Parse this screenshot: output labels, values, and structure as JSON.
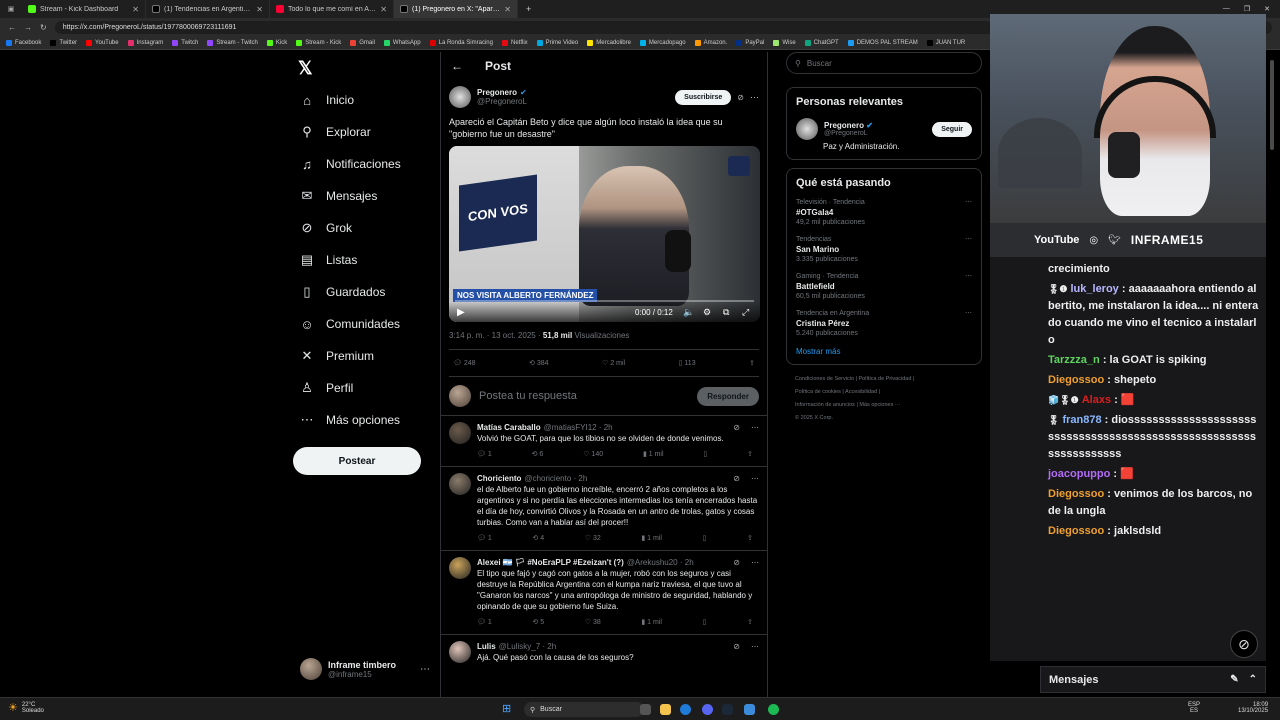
{
  "browser": {
    "tabs": [
      {
        "title": "Stream - Kick Dashboard",
        "color": "#53fc18"
      },
      {
        "title": "(1) Tendencias en Argentina (@p",
        "color": "#000000"
      },
      {
        "title": "Todo lo que me comí en Argentina",
        "color": "#ff0033"
      },
      {
        "title": "(1) Pregonero en X: \"Apareció el",
        "color": "#000000"
      }
    ],
    "url": "https://x.com/PregoneroL/status/1977800069723111691",
    "bookmarks": [
      "Facebook",
      "Twitter",
      "YouTube",
      "Instagram",
      "Twitch",
      "Stream - Twitch",
      "Kick",
      "Stream - Kick",
      "Gmail",
      "WhatsApp",
      "La Ronda Simracing",
      "Netflix",
      "Prime Video",
      "Mercadolibre",
      "Mercadopago",
      "Amazon.",
      "PayPal",
      "Wise",
      "ChatGPT",
      "DEMOS PAL STREAM",
      "JUAN TUR"
    ]
  },
  "nav": {
    "items": [
      {
        "label": "Inicio",
        "icon": "home-icon",
        "glyph": "⌂"
      },
      {
        "label": "Explorar",
        "icon": "search-icon",
        "glyph": "⚲"
      },
      {
        "label": "Notificaciones",
        "icon": "bell-icon",
        "glyph": "♫"
      },
      {
        "label": "Mensajes",
        "icon": "mail-icon",
        "glyph": "✉"
      },
      {
        "label": "Grok",
        "icon": "grok-icon",
        "glyph": "⊘"
      },
      {
        "label": "Listas",
        "icon": "list-icon",
        "glyph": "▤"
      },
      {
        "label": "Guardados",
        "icon": "bookmark-icon",
        "glyph": "▯"
      },
      {
        "label": "Comunidades",
        "icon": "communities-icon",
        "glyph": "☺"
      },
      {
        "label": "Premium",
        "icon": "x-logo-icon",
        "glyph": "✕"
      },
      {
        "label": "Perfil",
        "icon": "profile-icon",
        "glyph": "♙"
      },
      {
        "label": "Más opciones",
        "icon": "more-icon",
        "glyph": "⋯"
      }
    ],
    "post_button": "Postear",
    "account_name": "Inframe timbero",
    "account_handle": "@inframe15"
  },
  "post": {
    "header_title": "Post",
    "author_name": "Pregonero",
    "author_handle": "@PregoneroL",
    "subscribe": "Suscribirse",
    "text": "Apareció el Capitán Beto y dice que algún loco instaló la idea que su \"gobierno fue un desastre\"",
    "video": {
      "overlay_caption": "NOS VISITA ALBERTO FERNÁNDEZ",
      "logo_text": "CON VOS",
      "time": "0:00 / 0:12",
      "progress": 0
    },
    "timestamp": "3:14 p. m. · 13 oct. 2025 ·",
    "views_count": "51,8 mil",
    "views_label": "Visualizaciones",
    "replies": "248",
    "reposts": "384",
    "likes": "2 mil",
    "bookmarks": "113",
    "reply_placeholder": "Postea tu respuesta",
    "reply_button": "Responder"
  },
  "replies": [
    {
      "name": "Matías Caraballo",
      "handle": "@matiasFYI12 · 2h",
      "text": "Volvió the GOAT, para que los tibios no se olviden de donde venimos.",
      "comments": "1",
      "reposts": "6",
      "likes": "140",
      "views": "1 mil"
    },
    {
      "name": "Choriciento",
      "handle": "@choriciento · 2h",
      "text": "el de Alberto fue un gobierno increíble, encerró 2 años completos a los argentinos y si no perdía las elecciones intermedias los tenía encerrados hasta el día de hoy, convirtió Olivos y la Rosada en un antro de trolas, gatos y cosas turbias. Como van a hablar así del procer!!",
      "comments": "1",
      "reposts": "4",
      "likes": "32",
      "views": "1 mil"
    },
    {
      "name": "Alexei 🇦🇷 🏳 #NoEraPLP #Ezeizan't (?)",
      "handle": "@Arekushu20 · 2h",
      "text": "El tipo que fajó y cagó con gatos a la mujer, robó con los seguros y casi destruye la República Argentina con el kumpa nariz traviesa, el que tuvo al \"Ganaron los narcos\" y una antropóloga de ministro de seguridad, hablando y opinando de que su gobierno fue Suiza.",
      "comments": "1",
      "reposts": "5",
      "likes": "38",
      "views": "1 mil"
    },
    {
      "name": "Lulis",
      "handle": "@Lulisky_7 · 2h",
      "text": "Ajá. Qué pasó con la causa de los seguros?",
      "comments": "",
      "reposts": "",
      "likes": "",
      "views": ""
    }
  ],
  "sidebar": {
    "search_placeholder": "Buscar",
    "relevant_title": "Personas relevantes",
    "relevant_name": "Pregonero",
    "relevant_handle": "@PregoneroL",
    "relevant_bio": "Paz y Administración.",
    "follow": "Seguir",
    "trending_title": "Qué está pasando",
    "trends": [
      {
        "context": "Televisión · Tendencia",
        "topic": "#OTGala4",
        "count": "49,2 mil publicaciones"
      },
      {
        "context": "Tendencias",
        "topic": "San Marino",
        "count": "3.335 publicaciones"
      },
      {
        "context": "Gaming · Tendencia",
        "topic": "Battlefield",
        "count": "60,5 mil publicaciones"
      },
      {
        "context": "Tendencia en Argentina",
        "topic": "Cristina Pérez",
        "count": "5.240 publicaciones"
      }
    ],
    "show_more": "Mostrar más",
    "footer_line1": "Condiciones de Servicio | Política de Privacidad |",
    "footer_line2": "Política de cookies | Accesibilidad |",
    "footer_line3": "Información de anuncios | Más opciones ···",
    "footer_line4": "© 2025 X Corp."
  },
  "stream": {
    "banner_youtube": "YouTube",
    "banner_name": "INFRAME15",
    "chat": [
      {
        "user": "",
        "color": "#efeff1",
        "text": "crecimiento",
        "badges": ""
      },
      {
        "user": "luk_leroy",
        "color": "#b8b6ff",
        "text": "aaaaaaahora entiendo albertito, me instalaron la idea.... ni enterado cuando me vino el tecnico a instalarlo",
        "badges": "🎖❶"
      },
      {
        "user": "Tarzzza_n",
        "color": "#5fd35f",
        "text": "la GOAT is spiking",
        "badges": ""
      },
      {
        "user": "Diegossoo",
        "color": "#f0a030",
        "text": "shepeto",
        "badges": ""
      },
      {
        "user": "Alaxs",
        "color": "#d62020",
        "text": "🟥",
        "badges": "🧊🎖❶"
      },
      {
        "user": "fran878",
        "color": "#8ab8ff",
        "text": "diosssssssssssssssssssssssssssssssssssssssssssssssssssssssssssssssssss",
        "badges": "🎖"
      },
      {
        "user": "joacopuppo",
        "color": "#b36cf5",
        "text": "🟥",
        "badges": ""
      },
      {
        "user": "Diegossoo",
        "color": "#f0a030",
        "text": "venimos de los barcos, no de la ungla",
        "badges": ""
      },
      {
        "user": "Diegossoo",
        "color": "#f0a030",
        "text": "jaklsdsld",
        "badges": ""
      }
    ],
    "messages_label": "Mensajes"
  },
  "taskbar": {
    "weather_temp": "22°C",
    "weather_desc": "Soleado",
    "search": "Buscar",
    "lang": "ESP",
    "lang2": "ES",
    "time": "18:09",
    "date": "13/10/2025"
  },
  "colors": {
    "x_blue": "#1d9bf0",
    "kick_green": "#53fc18"
  }
}
